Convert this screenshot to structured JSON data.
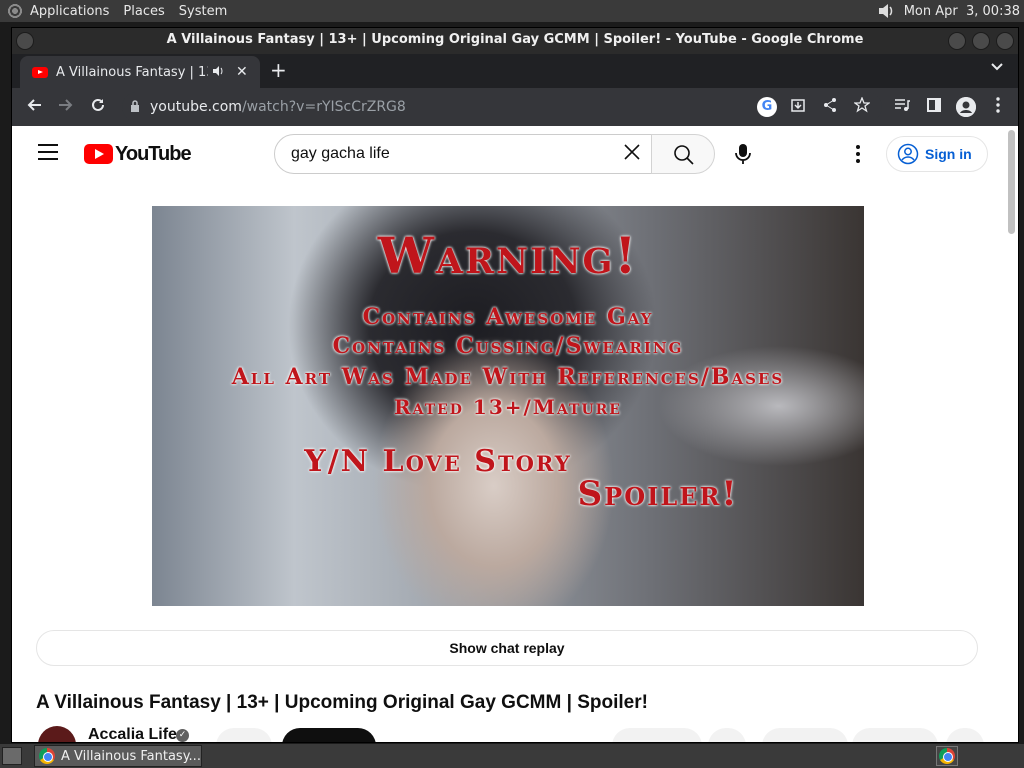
{
  "top_panel": {
    "menus": [
      "Applications",
      "Places",
      "System"
    ],
    "clock": "Mon Apr  3, 00:38"
  },
  "window": {
    "title": "A Villainous Fantasy | 13+ | Upcoming Original Gay GCMM | Spoiler! - YouTube - Google Chrome"
  },
  "tab": {
    "title": "A Villainous Fantasy | 13+",
    "close": "✕",
    "new_tab": "+"
  },
  "toolbar": {
    "url_host": "youtube.com",
    "url_path": "/watch?v=rYIScCrZRG8"
  },
  "youtube": {
    "logo_text": "YouTube",
    "search_value": "gay gacha life",
    "sign_in": "Sign in",
    "show_chat_replay": "Show chat replay",
    "video_title": "A Villainous Fantasy | 13+ | Upcoming Original Gay GCMM | Spoiler!",
    "channel_name": "Accalia Life"
  },
  "video_overlay": {
    "line_warning": "Warning!",
    "line_1": "Contains Awesome Gay",
    "line_2": "Contains Cussing/Swearing",
    "line_3": "All Art Was Made With References/Bases",
    "line_4": "Rated 13+/Mature",
    "line_5": "Y/N Love Story",
    "line_6": "Spoiler!"
  },
  "taskbar": {
    "task_label": "A Villainous Fantasy..."
  },
  "colors": {
    "yt_red": "#ff0000",
    "sign_in_blue": "#065fd4",
    "warning_red": "#c0151b"
  }
}
